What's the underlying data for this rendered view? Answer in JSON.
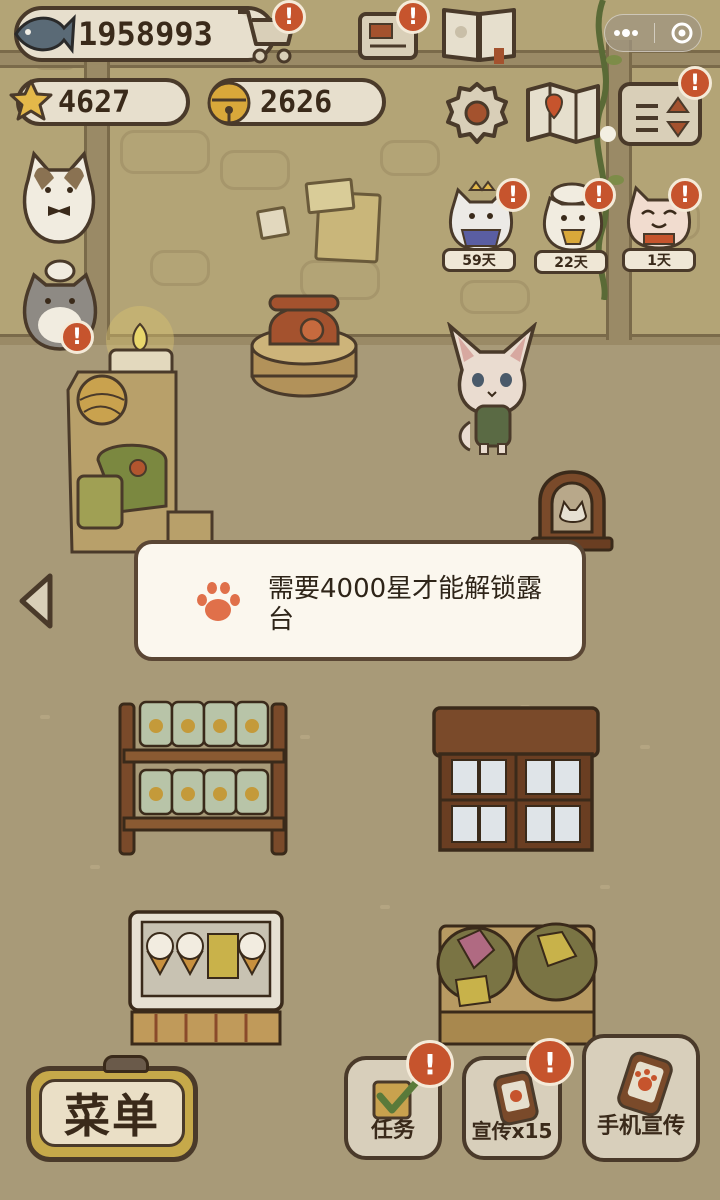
{
  "hud": {
    "fish_count": "1958993",
    "star_count": "4627",
    "bell_count": "2626",
    "badge_symbol": "!"
  },
  "cat_visitors": [
    {
      "days": "59天"
    },
    {
      "days": "22天"
    },
    {
      "days": "1天"
    }
  ],
  "toast": {
    "message": "需要4000星才能解锁露台"
  },
  "bottom_bar": {
    "menu_label": "菜单",
    "tasks_label": "任务",
    "promote_label": "宣传x15",
    "phone_promote_label": "手机宣传"
  },
  "colors": {
    "badge": "#c6542d",
    "paw": "#e0704a",
    "border": "#4a3a2a"
  }
}
